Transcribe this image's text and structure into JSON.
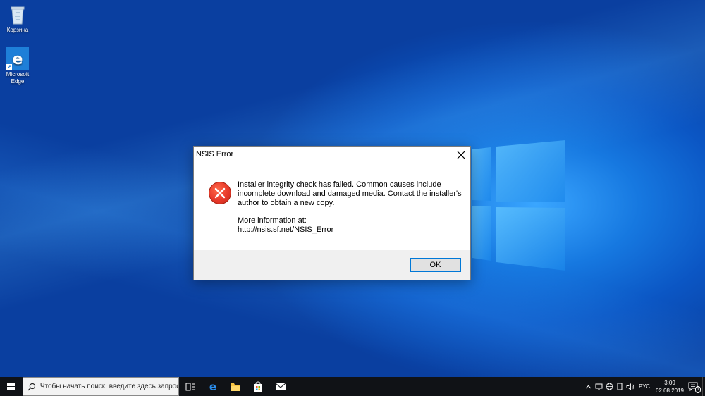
{
  "desktop": {
    "icons": [
      {
        "label": "Корзина",
        "icon": "recycle-bin-icon"
      },
      {
        "label": "Microsoft Edge",
        "icon": "edge-icon"
      }
    ]
  },
  "dialog": {
    "title": "NSIS Error",
    "icon": "error-icon",
    "message_line1": "Installer integrity check has failed. Common causes include incomplete download and damaged media. Contact the installer's author to obtain a new copy.",
    "message_line2": "More information at:",
    "message_line3": "http://nsis.sf.net/NSIS_Error",
    "ok_label": "OK"
  },
  "taskbar": {
    "search_placeholder": "Чтобы начать поиск, введите здесь запрос",
    "apps": [
      "task-view-icon",
      "edge-icon",
      "file-explorer-icon",
      "store-icon",
      "mail-icon"
    ],
    "language": "РУС",
    "time": "3:09",
    "date": "02.08.2019",
    "notification_count": "1"
  },
  "colors": {
    "accent": "#0078d7",
    "error_red": "#e8392a",
    "taskbar_bg": "#101216"
  }
}
